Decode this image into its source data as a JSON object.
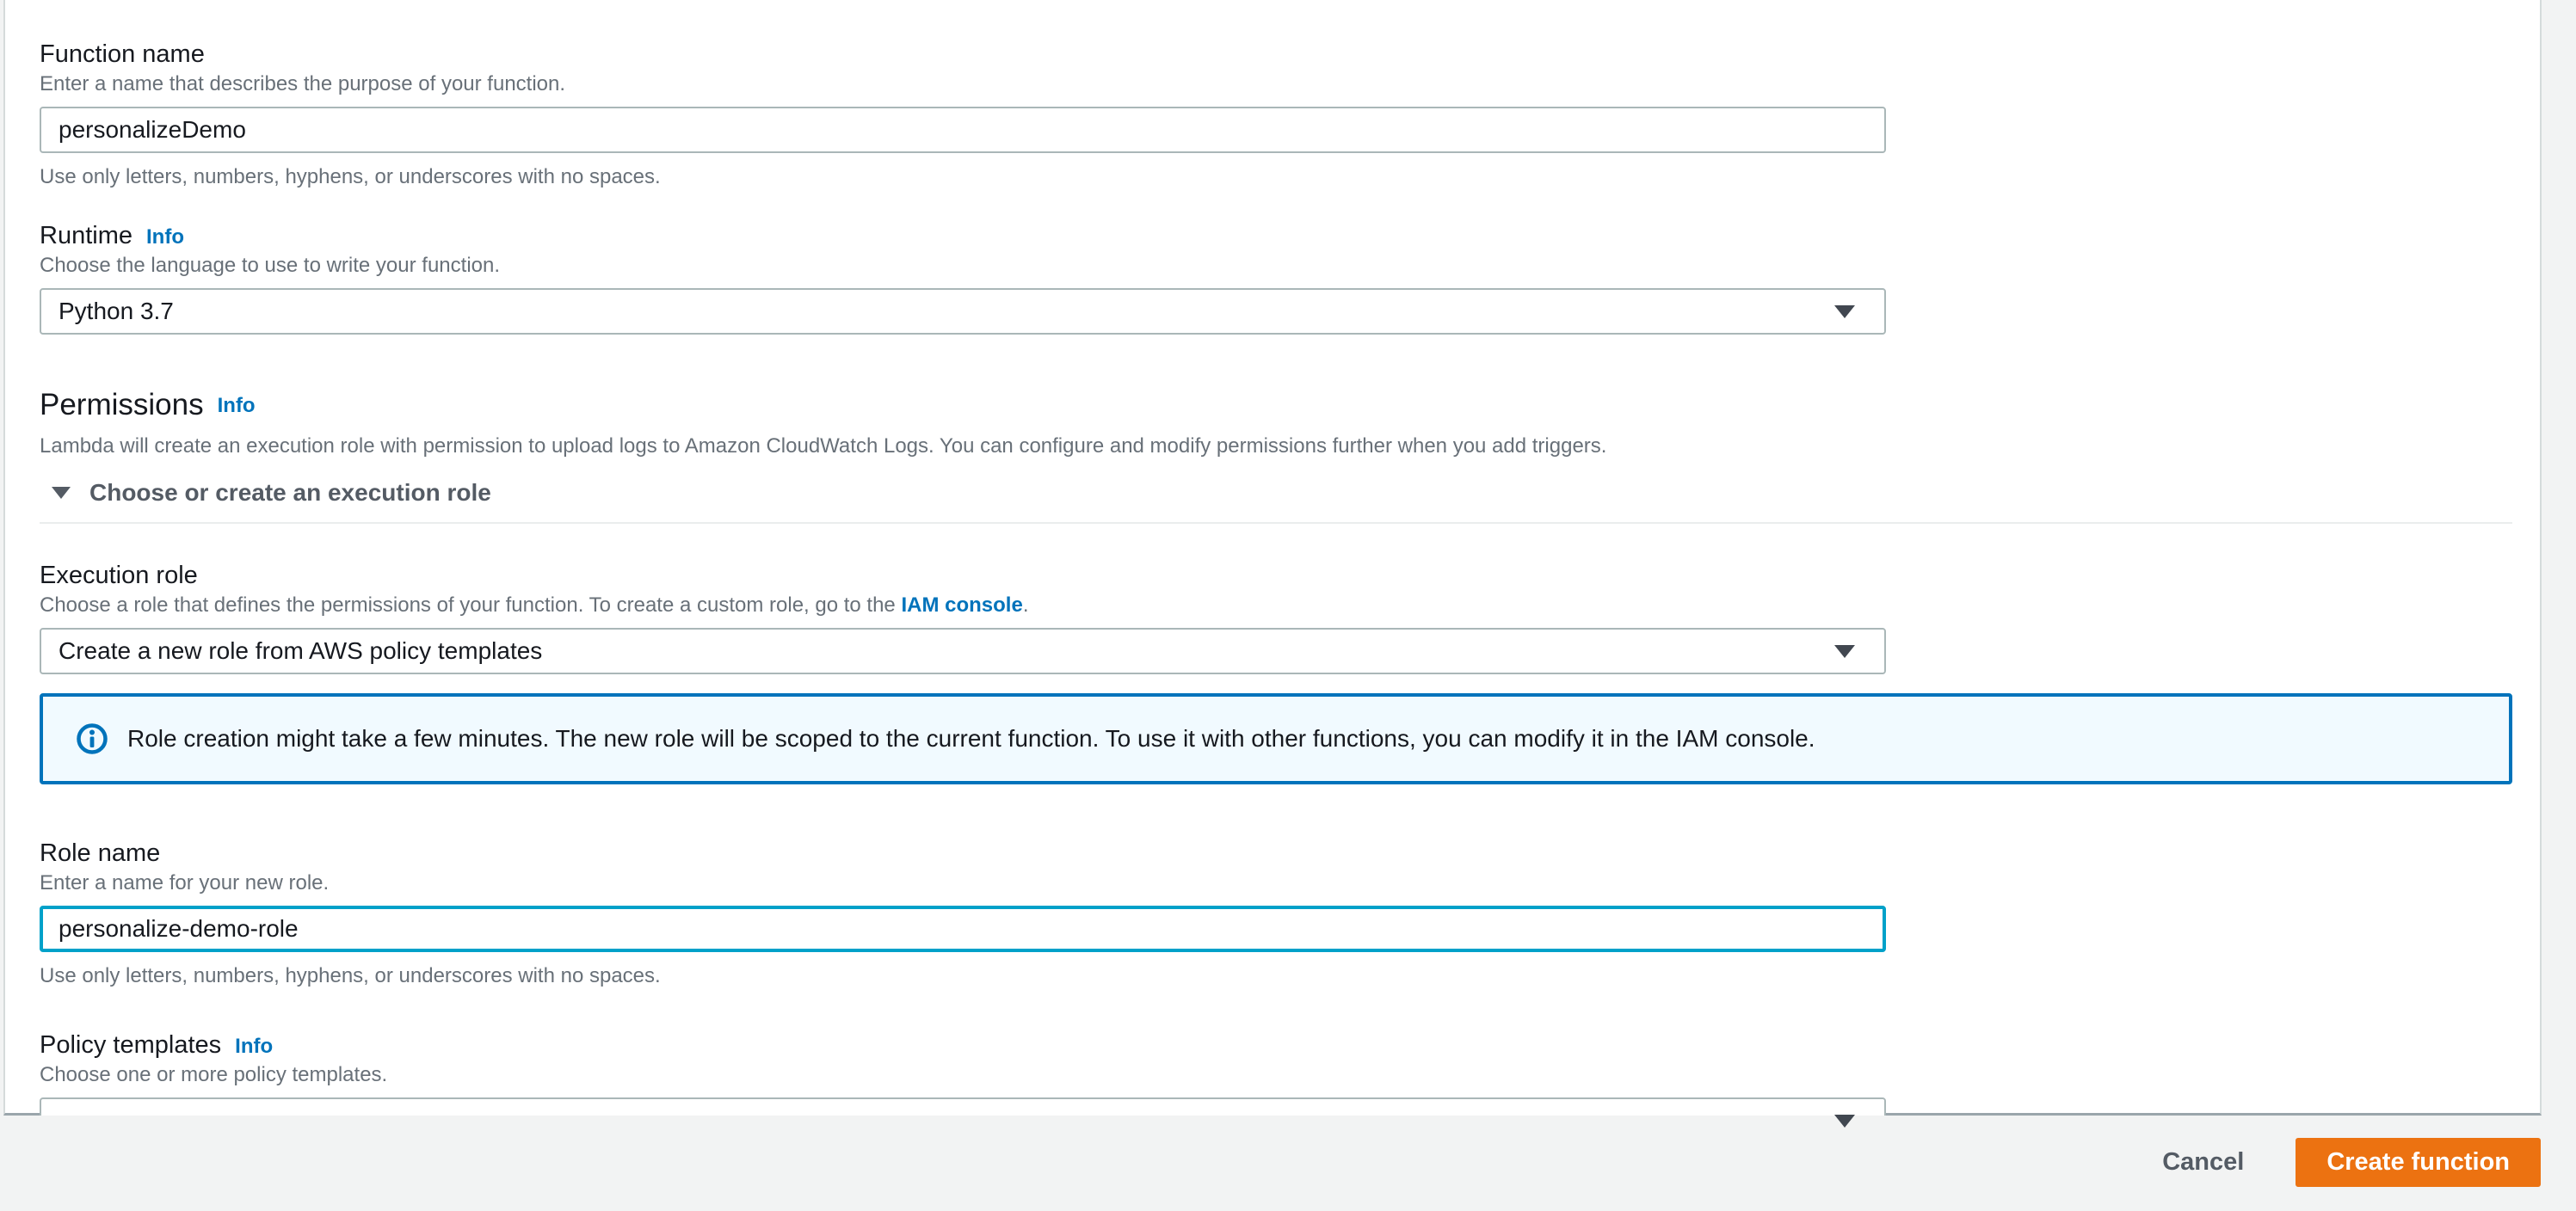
{
  "form": {
    "function_name": {
      "label": "Function name",
      "description": "Enter a name that describes the purpose of your function.",
      "value": "personalizeDemo",
      "constraint": "Use only letters, numbers, hyphens, or underscores with no spaces."
    },
    "runtime": {
      "label": "Runtime",
      "info_label": "Info",
      "description": "Choose the language to use to write your function.",
      "value": "Python 3.7"
    },
    "permissions": {
      "title": "Permissions",
      "info_label": "Info",
      "description": "Lambda will create an execution role with permission to upload logs to Amazon CloudWatch Logs. You can configure and modify permissions further when you add triggers.",
      "expander_label": "Choose or create an execution role"
    },
    "execution_role": {
      "label": "Execution role",
      "description_prefix": "Choose a role that defines the permissions of your function. To create a custom role, go to the ",
      "link_text": "IAM console",
      "description_suffix": ".",
      "value": "Create a new role from AWS policy templates"
    },
    "alert": {
      "text": "Role creation might take a few minutes. The new role will be scoped to the current function. To use it with other functions, you can modify it in the IAM console."
    },
    "role_name": {
      "label": "Role name",
      "description": "Enter a name for your new role.",
      "value": "personalize-demo-role",
      "constraint": "Use only letters, numbers, hyphens, or underscores with no spaces."
    },
    "policy_templates": {
      "label": "Policy templates",
      "info_label": "Info",
      "description": "Choose one or more policy templates.",
      "value": ""
    }
  },
  "footer": {
    "cancel_label": "Cancel",
    "create_label": "Create function"
  },
  "icons": {
    "dropdown": "down-triangle-icon",
    "expander": "down-triangle-icon",
    "alert": "info-circle-icon"
  },
  "colors": {
    "primary_button": "#ec7211",
    "link_blue": "#0073bb",
    "focus_teal": "#00a1c9",
    "alert_border": "#0073bb",
    "alert_background": "#f1faff",
    "page_background": "#f2f3f3",
    "field_border": "#aab7b8"
  }
}
